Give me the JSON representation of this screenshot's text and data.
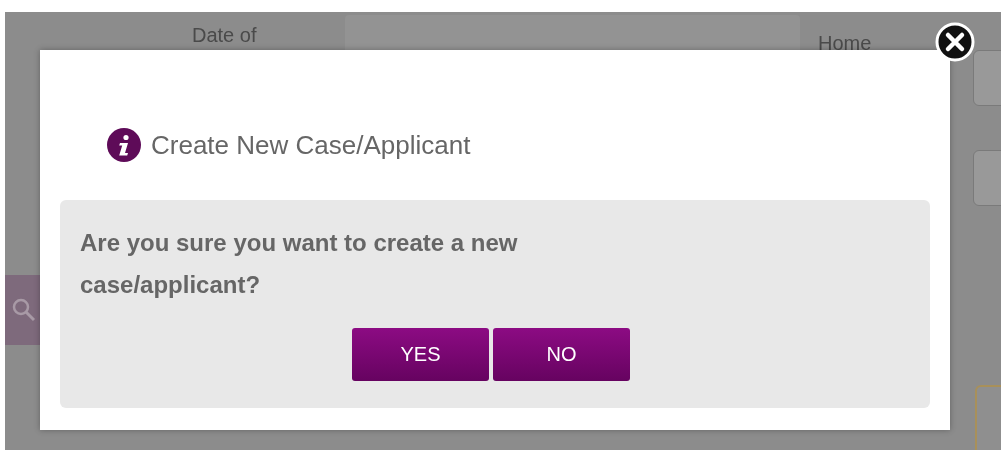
{
  "background": {
    "labels": [
      "Date of",
      "Home"
    ]
  },
  "dialog": {
    "title": "Create New Case/Applicant",
    "message": "Are you sure you want to create a new case/applicant?",
    "buttons": [
      "YES",
      "NO"
    ]
  }
}
